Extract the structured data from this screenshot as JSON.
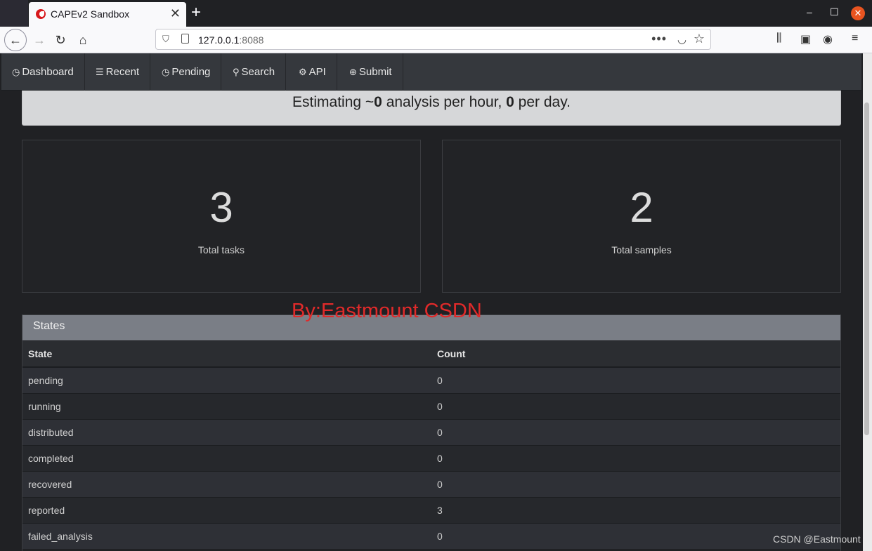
{
  "browser": {
    "tab_title": "CAPEv2 Sandbox",
    "tab_close": "✕",
    "new_tab": "+",
    "url_host": "127.0.0.1",
    "url_port": ":8088",
    "window_controls": {
      "minimize": "–",
      "maximize": "☐",
      "close": "✕"
    }
  },
  "nav": {
    "items": [
      {
        "label": "Dashboard",
        "icon": "dashboard-icon"
      },
      {
        "label": "Recent",
        "icon": "list-icon"
      },
      {
        "label": "Pending",
        "icon": "clock-icon"
      },
      {
        "label": "Search",
        "icon": "search-icon"
      },
      {
        "label": "API",
        "icon": "gear-icon"
      },
      {
        "label": "Submit",
        "icon": "upload-icon"
      }
    ]
  },
  "estimate": {
    "prefix": "Estimating ~",
    "per_hour": "0",
    "middle": " analysis per hour, ",
    "per_day": "0",
    "suffix": " per day."
  },
  "stats": {
    "tasks": {
      "value": "3",
      "label": "Total tasks"
    },
    "samples": {
      "value": "2",
      "label": "Total samples"
    }
  },
  "watermark": "By:Eastmount CSDN",
  "states": {
    "title": "States",
    "columns": [
      "State",
      "Count"
    ],
    "rows": [
      {
        "state": "pending",
        "count": "0"
      },
      {
        "state": "running",
        "count": "0"
      },
      {
        "state": "distributed",
        "count": "0"
      },
      {
        "state": "completed",
        "count": "0"
      },
      {
        "state": "recovered",
        "count": "0"
      },
      {
        "state": "reported",
        "count": "3"
      },
      {
        "state": "failed_analysis",
        "count": "0"
      }
    ]
  },
  "footer_watermark": "CSDN @Eastmount",
  "colors": {
    "accent_close": "#e95420",
    "favicon": "#d7191c",
    "watermark": "#e02a2a"
  }
}
